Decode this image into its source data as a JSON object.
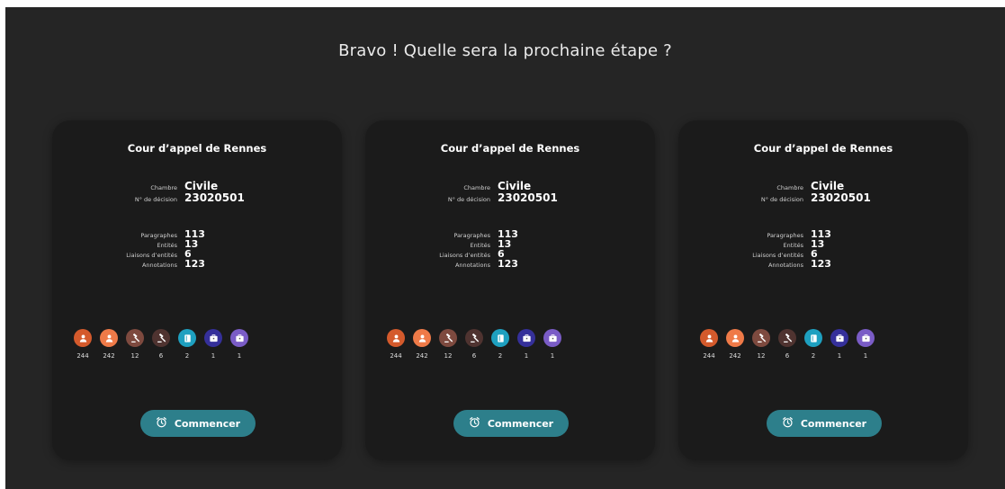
{
  "headline": "Bravo ! Quelle sera la prochaine étape ?",
  "colors": {
    "background": "#252525",
    "card": "#1b1b1b",
    "button": "#2d7f8b",
    "tag_person_dark": "#d45a2c",
    "tag_person_light": "#ef7a48",
    "tag_gavel_brown": "#7e4a3f",
    "tag_gavel_dark": "#4f3330",
    "tag_book": "#1ea0c0",
    "tag_building_navy": "#35309a",
    "tag_building_purple": "#7a5cc6"
  },
  "cards": [
    {
      "title": "Cour d’appel de Rennes",
      "fields": [
        {
          "label": "Chambre",
          "value": "Civile"
        },
        {
          "label": "N° de décision",
          "value": "23020501"
        }
      ],
      "stats": [
        {
          "label": "Paragraphes",
          "value": "113"
        },
        {
          "label": "Entités",
          "value": "13"
        },
        {
          "label": "Liaisons d’entités",
          "value": "6"
        },
        {
          "label": "Annotations",
          "value": "123"
        }
      ],
      "tags": [
        {
          "icon": "person-icon",
          "color": "#d45a2c",
          "count": "244"
        },
        {
          "icon": "person-icon",
          "color": "#ef7a48",
          "count": "242"
        },
        {
          "icon": "gavel-icon",
          "color": "#7e4a3f",
          "count": "12"
        },
        {
          "icon": "gavel-icon",
          "color": "#4f3330",
          "count": "6"
        },
        {
          "icon": "book-icon",
          "color": "#1ea0c0",
          "count": "2"
        },
        {
          "icon": "building-icon",
          "color": "#35309a",
          "count": "1"
        },
        {
          "icon": "building-icon",
          "color": "#7a5cc6",
          "count": "1"
        }
      ],
      "button": {
        "label": "Commencer",
        "icon": "alarm-clock-icon"
      }
    },
    {
      "title": "Cour d’appel de Rennes",
      "fields": [
        {
          "label": "Chambre",
          "value": "Civile"
        },
        {
          "label": "N° de décision",
          "value": "23020501"
        }
      ],
      "stats": [
        {
          "label": "Paragraphes",
          "value": "113"
        },
        {
          "label": "Entités",
          "value": "13"
        },
        {
          "label": "Liaisons d’entités",
          "value": "6"
        },
        {
          "label": "Annotations",
          "value": "123"
        }
      ],
      "tags": [
        {
          "icon": "person-icon",
          "color": "#d45a2c",
          "count": "244"
        },
        {
          "icon": "person-icon",
          "color": "#ef7a48",
          "count": "242"
        },
        {
          "icon": "gavel-icon",
          "color": "#7e4a3f",
          "count": "12"
        },
        {
          "icon": "gavel-icon",
          "color": "#4f3330",
          "count": "6"
        },
        {
          "icon": "book-icon",
          "color": "#1ea0c0",
          "count": "2"
        },
        {
          "icon": "building-icon",
          "color": "#35309a",
          "count": "1"
        },
        {
          "icon": "building-icon",
          "color": "#7a5cc6",
          "count": "1"
        }
      ],
      "button": {
        "label": "Commencer",
        "icon": "alarm-clock-icon"
      }
    },
    {
      "title": "Cour d’appel de Rennes",
      "fields": [
        {
          "label": "Chambre",
          "value": "Civile"
        },
        {
          "label": "N° de décision",
          "value": "23020501"
        }
      ],
      "stats": [
        {
          "label": "Paragraphes",
          "value": "113"
        },
        {
          "label": "Entités",
          "value": "13"
        },
        {
          "label": "Liaisons d’entités",
          "value": "6"
        },
        {
          "label": "Annotations",
          "value": "123"
        }
      ],
      "tags": [
        {
          "icon": "person-icon",
          "color": "#d45a2c",
          "count": "244"
        },
        {
          "icon": "person-icon",
          "color": "#ef7a48",
          "count": "242"
        },
        {
          "icon": "gavel-icon",
          "color": "#7e4a3f",
          "count": "12"
        },
        {
          "icon": "gavel-icon",
          "color": "#4f3330",
          "count": "6"
        },
        {
          "icon": "book-icon",
          "color": "#1ea0c0",
          "count": "2"
        },
        {
          "icon": "building-icon",
          "color": "#35309a",
          "count": "1"
        },
        {
          "icon": "building-icon",
          "color": "#7a5cc6",
          "count": "1"
        }
      ],
      "button": {
        "label": "Commencer",
        "icon": "alarm-clock-icon"
      }
    }
  ]
}
